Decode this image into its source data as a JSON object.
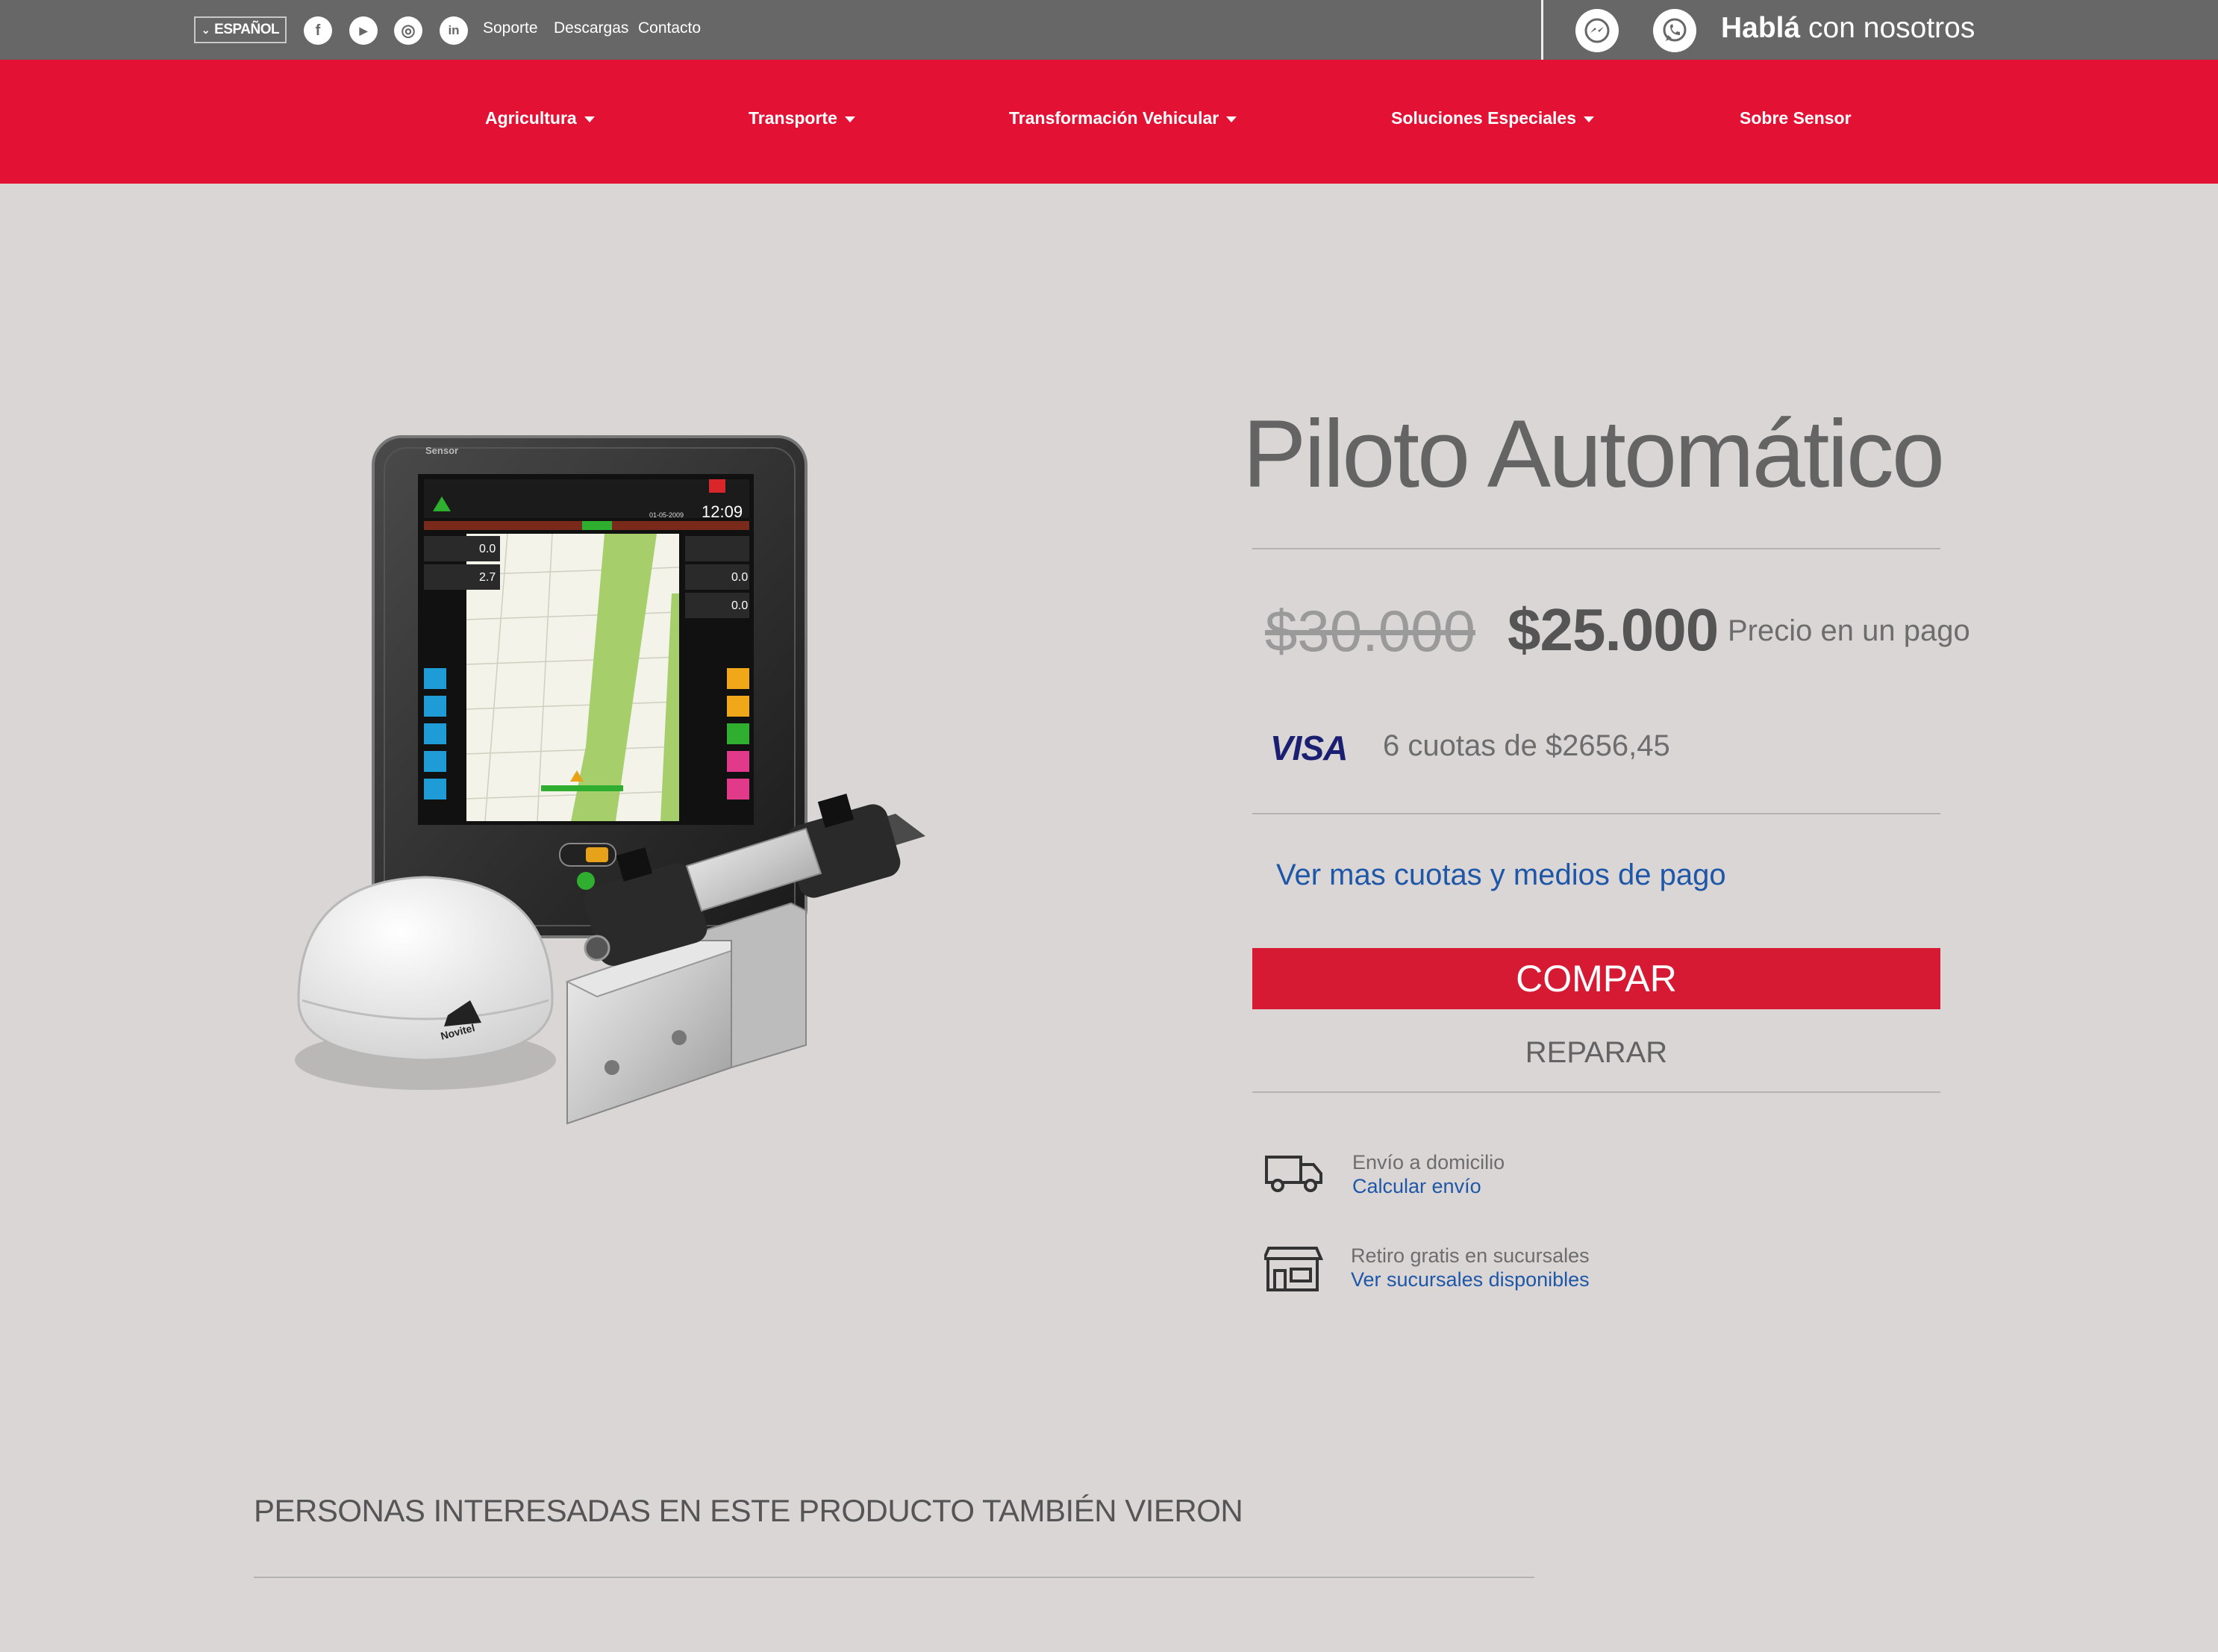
{
  "topbar": {
    "language": "ESPAÑOL",
    "social": [
      {
        "name": "facebook-icon",
        "glyph": "f"
      },
      {
        "name": "youtube-icon",
        "glyph": "▶"
      },
      {
        "name": "instagram-icon",
        "glyph": "◎"
      },
      {
        "name": "linkedin-icon",
        "glyph": "in"
      }
    ],
    "links": [
      "Soporte",
      "Descargas",
      "Contacto"
    ],
    "chat_strong": "Hablá",
    "chat_rest": " con nosotros"
  },
  "nav": {
    "items": [
      {
        "label": "Agricultura",
        "dropdown": true
      },
      {
        "label": "Transporte",
        "dropdown": true
      },
      {
        "label": "Transformación Vehicular",
        "dropdown": true
      },
      {
        "label": "Soluciones Especiales",
        "dropdown": true
      },
      {
        "label": "Sobre Sensor",
        "dropdown": false
      }
    ]
  },
  "product": {
    "title": "Piloto Automático",
    "old_price": "$30.000",
    "price": "$25.000",
    "price_note": "Precio en un pago",
    "card_brand": "VISA",
    "installments": "6 cuotas de $2656,45",
    "more_payments": "Ver mas cuotas y medios de pago",
    "buy_label": "COMPAR",
    "repair_label": "REPARAR",
    "image": {
      "brand_text": "Sensor",
      "screen_time": "12:09",
      "screen_date": "01-05-2009",
      "antenna_brand": "Novitel",
      "values": [
        "0.0",
        "2.7",
        "0.0",
        "0.0"
      ]
    }
  },
  "shipping": {
    "delivery_title": "Envío a domicilio",
    "delivery_link": "Calcular envío",
    "pickup_title": "Retiro gratis en sucursales",
    "pickup_link": "Ver sucursales disponibles"
  },
  "related": {
    "title": "PERSONAS INTERESADAS EN ESTE PRODUCTO TAMBIÉN VIERON"
  },
  "colors": {
    "topbar": "#676767",
    "nav": "#e31235",
    "buy_button": "#d71a33",
    "link": "#1f57a8",
    "page_bg": "#d9d6d5"
  }
}
